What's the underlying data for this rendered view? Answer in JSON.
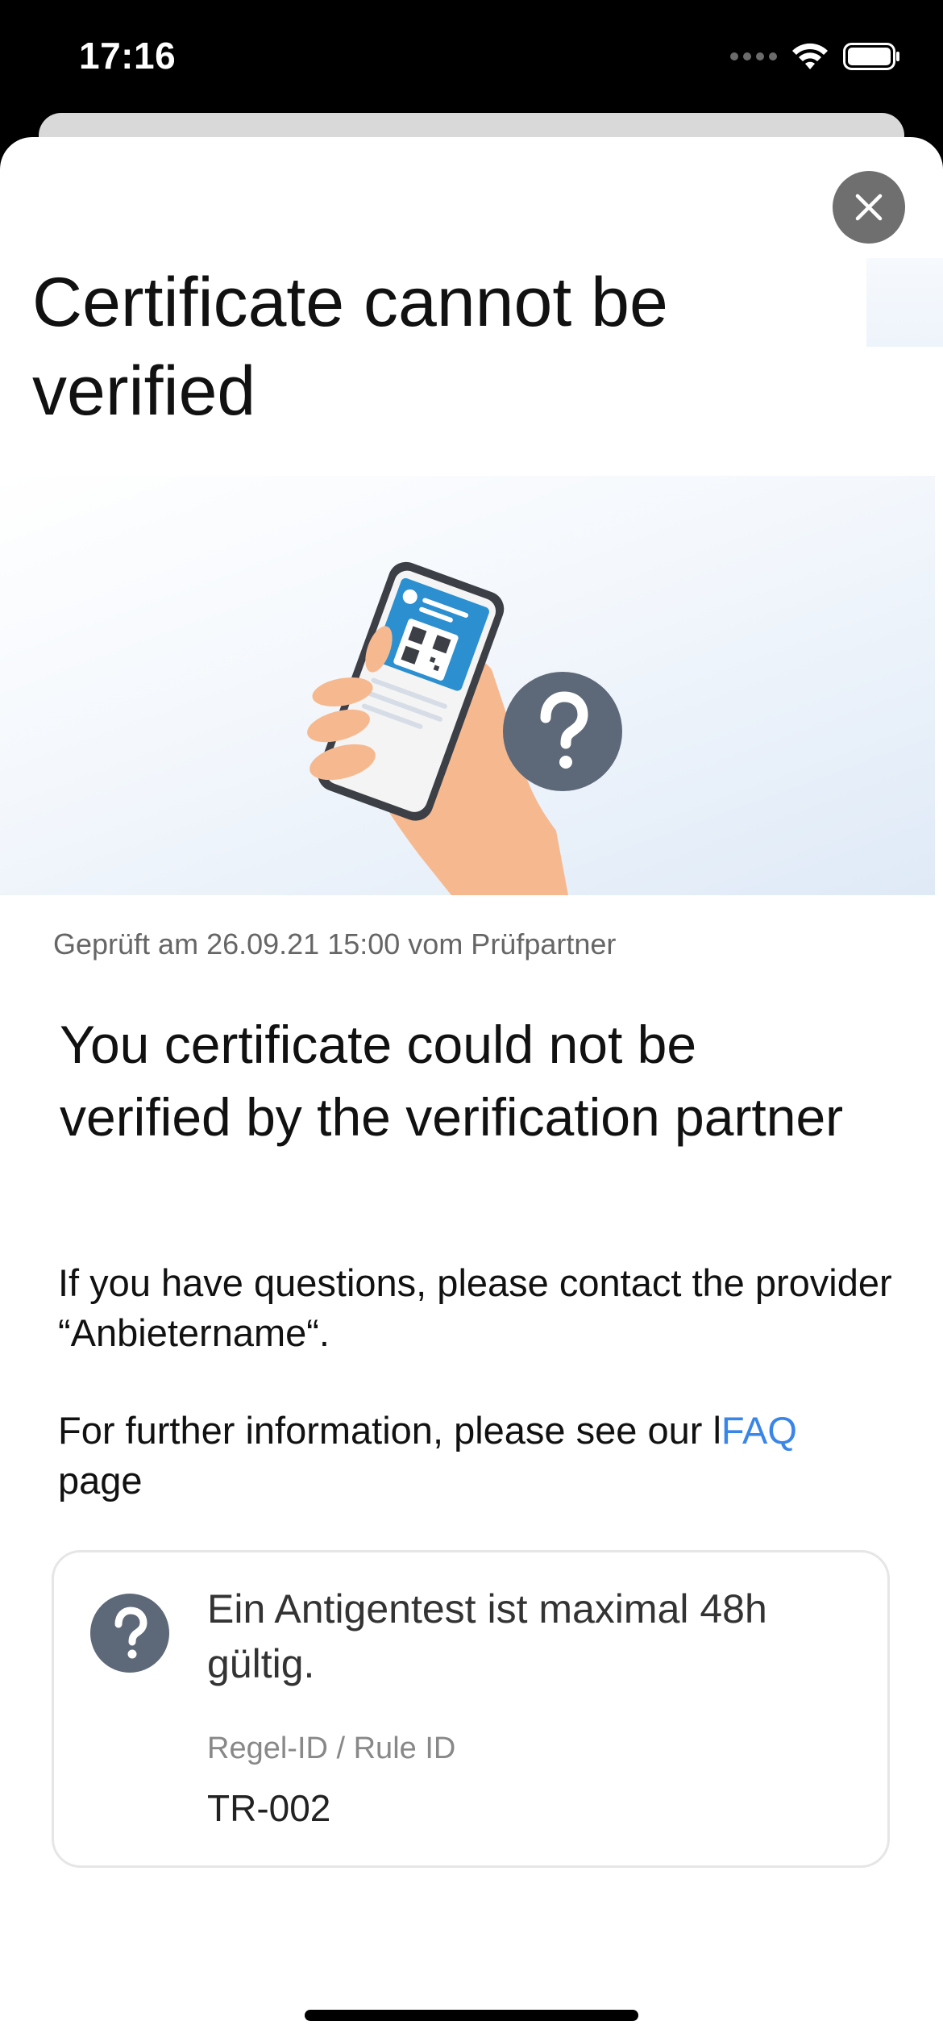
{
  "status_bar": {
    "time": "17:16"
  },
  "modal": {
    "title": "Certificate cannot be verified",
    "close_icon": "close-icon",
    "hero_icon": "phone-qr-question-illustration",
    "check_info": "Geprüft am 26.09.21 15:00 vom Prüfpartner",
    "subtitle": "You certificate could not be verified by the verification partner",
    "contact_text": "If you have questions, please contact the provider “Anbietername“.",
    "info_prefix": "For further information, please see our l",
    "faq_link": "FAQ",
    "info_suffix": "page",
    "accent_color": "#3a86e8"
  },
  "rule": {
    "icon": "question-icon",
    "text": "Ein Antigentest ist maximal 48h gültig.",
    "id_label": "Regel-ID / Rule ID",
    "id_value": "TR-002"
  }
}
